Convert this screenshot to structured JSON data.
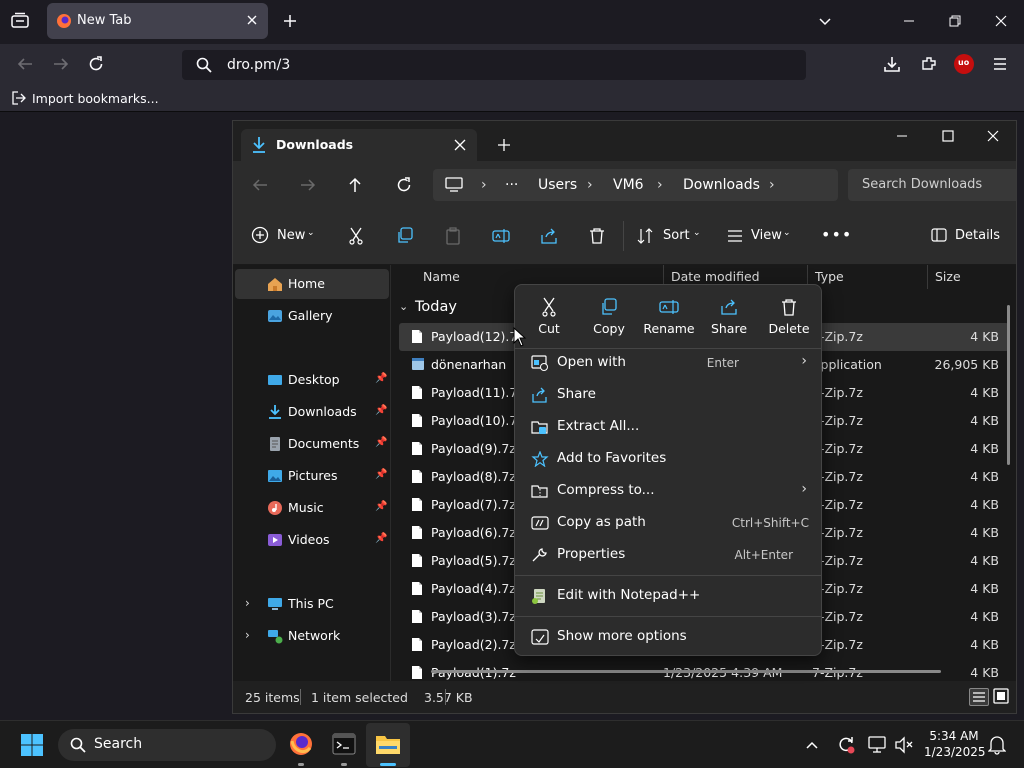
{
  "browser": {
    "tab_title": "New Tab",
    "url": "dro.pm/3",
    "bookmark_import_label": "Import bookmarks...",
    "extension_badge": "uo"
  },
  "explorer": {
    "tab_title": "Downloads",
    "breadcrumb": [
      "Users",
      "VM6",
      "Downloads"
    ],
    "search_placeholder": "Search Downloads",
    "toolbar": {
      "new_label": "New",
      "sort_label": "Sort",
      "view_label": "View",
      "details_label": "Details"
    },
    "nav": {
      "home": "Home",
      "gallery": "Gallery",
      "desktop": "Desktop",
      "downloads": "Downloads",
      "documents": "Documents",
      "pictures": "Pictures",
      "music": "Music",
      "videos": "Videos",
      "this_pc": "This PC",
      "network": "Network"
    },
    "columns": {
      "name": "Name",
      "date_modified": "Date modified",
      "type": "Type",
      "size": "Size"
    },
    "group_label": "Today",
    "files": [
      {
        "name": "Payload(12).7z",
        "type": "7-Zip.7z",
        "size": "4 KB"
      },
      {
        "name": "dönenarhan",
        "type": "Application",
        "size": "26,905 KB"
      },
      {
        "name": "Payload(11).7z",
        "type": "7-Zip.7z",
        "size": "4 KB"
      },
      {
        "name": "Payload(10).7z",
        "type": "7-Zip.7z",
        "size": "4 KB"
      },
      {
        "name": "Payload(9).7z",
        "type": "7-Zip.7z",
        "size": "4 KB"
      },
      {
        "name": "Payload(8).7z",
        "type": "7-Zip.7z",
        "size": "4 KB"
      },
      {
        "name": "Payload(7).7z",
        "type": "7-Zip.7z",
        "size": "4 KB"
      },
      {
        "name": "Payload(6).7z",
        "type": "7-Zip.7z",
        "size": "4 KB"
      },
      {
        "name": "Payload(5).7z",
        "type": "7-Zip.7z",
        "size": "4 KB"
      },
      {
        "name": "Payload(4).7z",
        "type": "7-Zip.7z",
        "size": "4 KB"
      },
      {
        "name": "Payload(3).7z",
        "type": "7-Zip.7z",
        "size": "4 KB"
      },
      {
        "name": "Payload(2).7z",
        "type": "7-Zip.7z",
        "size": "4 KB"
      },
      {
        "name": "Payload(1).7z",
        "date": "1/23/2025 4:39 AM",
        "type": "7-Zip.7z",
        "size": "4 KB"
      }
    ],
    "status": {
      "items": "25 items",
      "selected": "1 item selected",
      "size": "3.57 KB"
    }
  },
  "context_menu": {
    "quick_actions": [
      "Cut",
      "Copy",
      "Rename",
      "Share",
      "Delete"
    ],
    "items": [
      {
        "label": "Open with",
        "shortcut": "Enter"
      },
      {
        "label": "Share",
        "shortcut": ""
      },
      {
        "label": "Extract All...",
        "shortcut": ""
      },
      {
        "label": "Add to Favorites",
        "shortcut": ""
      },
      {
        "label": "Compress to...",
        "shortcut": ""
      },
      {
        "label": "Copy as path",
        "shortcut": "Ctrl+Shift+C"
      },
      {
        "label": "Properties",
        "shortcut": "Alt+Enter"
      },
      {
        "label": "Edit with Notepad++",
        "shortcut": ""
      },
      {
        "label": "Show more options",
        "shortcut": ""
      }
    ]
  },
  "taskbar": {
    "search_label": "Search",
    "time": "5:34 AM",
    "date": "1/23/2025"
  },
  "colors": {
    "accent": "#4cc2ff",
    "firefox_orange": "#ff7139",
    "folder_yellow": "#f8c544"
  }
}
